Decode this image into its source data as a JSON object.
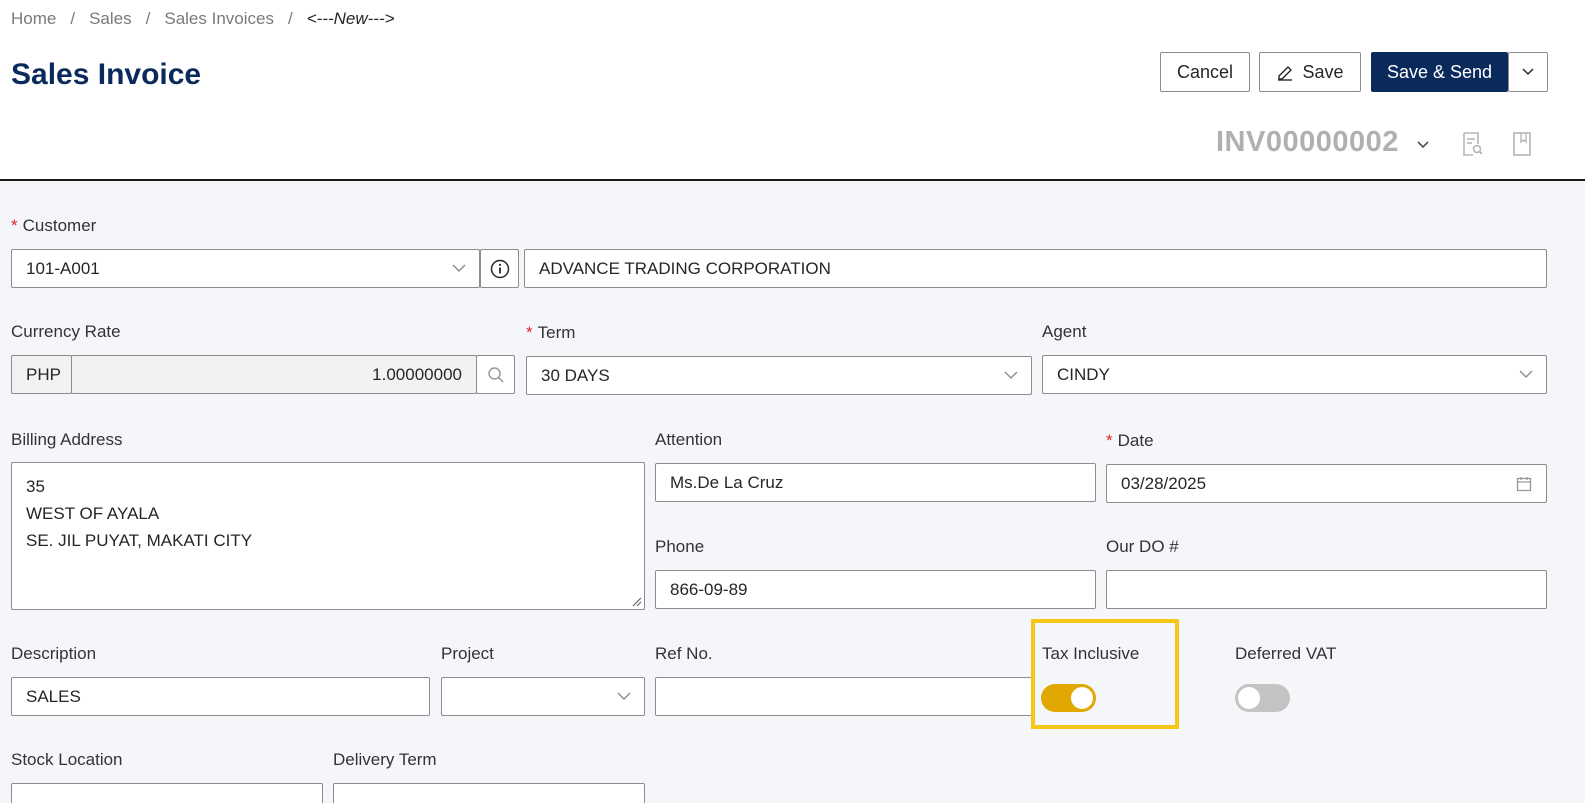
{
  "breadcrumb": {
    "items": [
      "Home",
      "Sales",
      "Sales Invoices"
    ],
    "current": "<---New--->"
  },
  "page": {
    "title": "Sales Invoice",
    "invoice_number": "INV00000002"
  },
  "toolbar": {
    "cancel_label": "Cancel",
    "save_label": "Save",
    "save_send_label": "Save & Send"
  },
  "form": {
    "customer": {
      "label": "Customer",
      "code": "101-A001",
      "name": "ADVANCE TRADING CORPORATION"
    },
    "currency_rate": {
      "label": "Currency Rate",
      "currency": "PHP",
      "rate": "1.00000000"
    },
    "term": {
      "label": "Term",
      "value": "30 DAYS"
    },
    "agent": {
      "label": "Agent",
      "value": "CINDY"
    },
    "billing_address": {
      "label": "Billing Address",
      "lines": [
        "35",
        "WEST OF AYALA",
        "SE. JIL PUYAT, MAKATI CITY"
      ]
    },
    "attention": {
      "label": "Attention",
      "value": "Ms.De La Cruz"
    },
    "date": {
      "label": "Date",
      "value": "03/28/2025"
    },
    "phone": {
      "label": "Phone",
      "value": "866-09-89"
    },
    "our_do": {
      "label": "Our DO #",
      "value": ""
    },
    "description": {
      "label": "Description",
      "value": "SALES"
    },
    "project": {
      "label": "Project",
      "value": ""
    },
    "ref_no": {
      "label": "Ref No.",
      "value": ""
    },
    "tax_inclusive": {
      "label": "Tax Inclusive",
      "on": true
    },
    "deferred_vat": {
      "label": "Deferred VAT",
      "on": false
    },
    "stock_location": {
      "label": "Stock Location",
      "value": ""
    },
    "delivery_term": {
      "label": "Delivery Term",
      "value": ""
    }
  },
  "colors": {
    "primary": "#0b2a5c",
    "toggle_on": "#e0a800",
    "toggle_off": "#c4c4c4",
    "highlight": "#f5c518",
    "required": "#e02424"
  }
}
